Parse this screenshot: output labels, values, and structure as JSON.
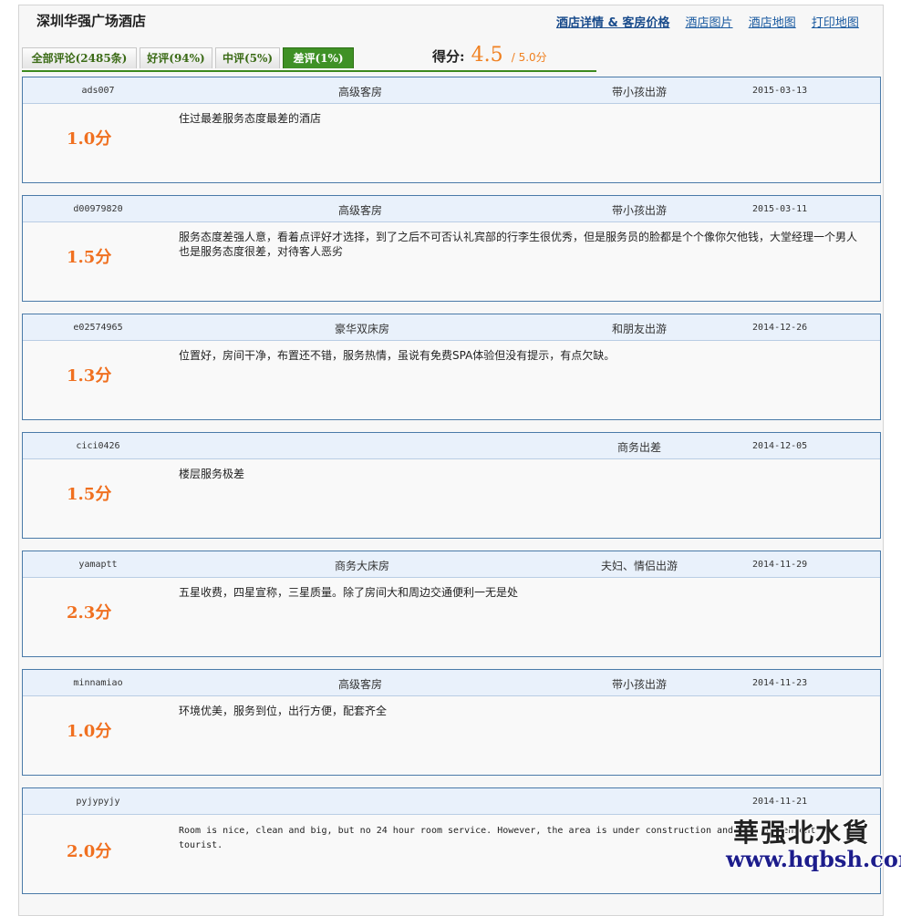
{
  "hotel": {
    "name": "深圳华强广场酒店"
  },
  "links": [
    {
      "label": "酒店详情 & 客房价格"
    },
    {
      "label": "酒店图片"
    },
    {
      "label": "酒店地图"
    },
    {
      "label": "打印地图"
    }
  ],
  "tabs": [
    {
      "label": "全部评论(2485条)"
    },
    {
      "label": "好评(94%)"
    },
    {
      "label": "中评(5%)"
    },
    {
      "label": "差评(1%)"
    }
  ],
  "score": {
    "label": "得分:",
    "value": "4.5",
    "max": "/ 5.0分"
  },
  "reviews": [
    {
      "user": "ads007",
      "room": "高级客房",
      "trip": "带小孩出游",
      "date": "2015-03-13",
      "score": "1.0分",
      "text": "住过最差服务态度最差的酒店"
    },
    {
      "user": "d00979820",
      "room": "高级客房",
      "trip": "带小孩出游",
      "date": "2015-03-11",
      "score": "1.5分",
      "text": "服务态度差强人意，看着点评好才选择，到了之后不可否认礼宾部的行李生很优秀，但是服务员的脸都是个个像你欠他钱，大堂经理一个男人也是服务态度很差，对待客人恶劣"
    },
    {
      "user": "e02574965",
      "room": "豪华双床房",
      "trip": "和朋友出游",
      "date": "2014-12-26",
      "score": "1.3分",
      "text": "位置好，房间干净，布置还不错，服务热情，虽说有免费SPA体验但没有提示，有点欠缺。"
    },
    {
      "user": "cici0426",
      "room": "",
      "trip": "商务出差",
      "date": "2014-12-05",
      "score": "1.5分",
      "text": "楼层服务极差"
    },
    {
      "user": "yamaptt",
      "room": "商务大床房",
      "trip": "夫妇、情侣出游",
      "date": "2014-11-29",
      "score": "2.3分",
      "text": "五星收费，四星宣称，三星质量。除了房间大和周边交通便利一无是处"
    },
    {
      "user": "minnamiao",
      "room": "高级客房",
      "trip": "带小孩出游",
      "date": "2014-11-23",
      "score": "1.0分",
      "text": "环境优美，服务到位，出行方便，配套齐全"
    },
    {
      "user": "pyjypyjy",
      "room": "",
      "trip": "",
      "date": "2014-11-21",
      "score": "2.0分",
      "text": "Room is nice, clean and big, but no 24 hour room service. However, the area is under construction and not convenient for tourist."
    }
  ],
  "watermark": {
    "cn": "華强北水貨",
    "url": "www.hqbsh.com"
  }
}
